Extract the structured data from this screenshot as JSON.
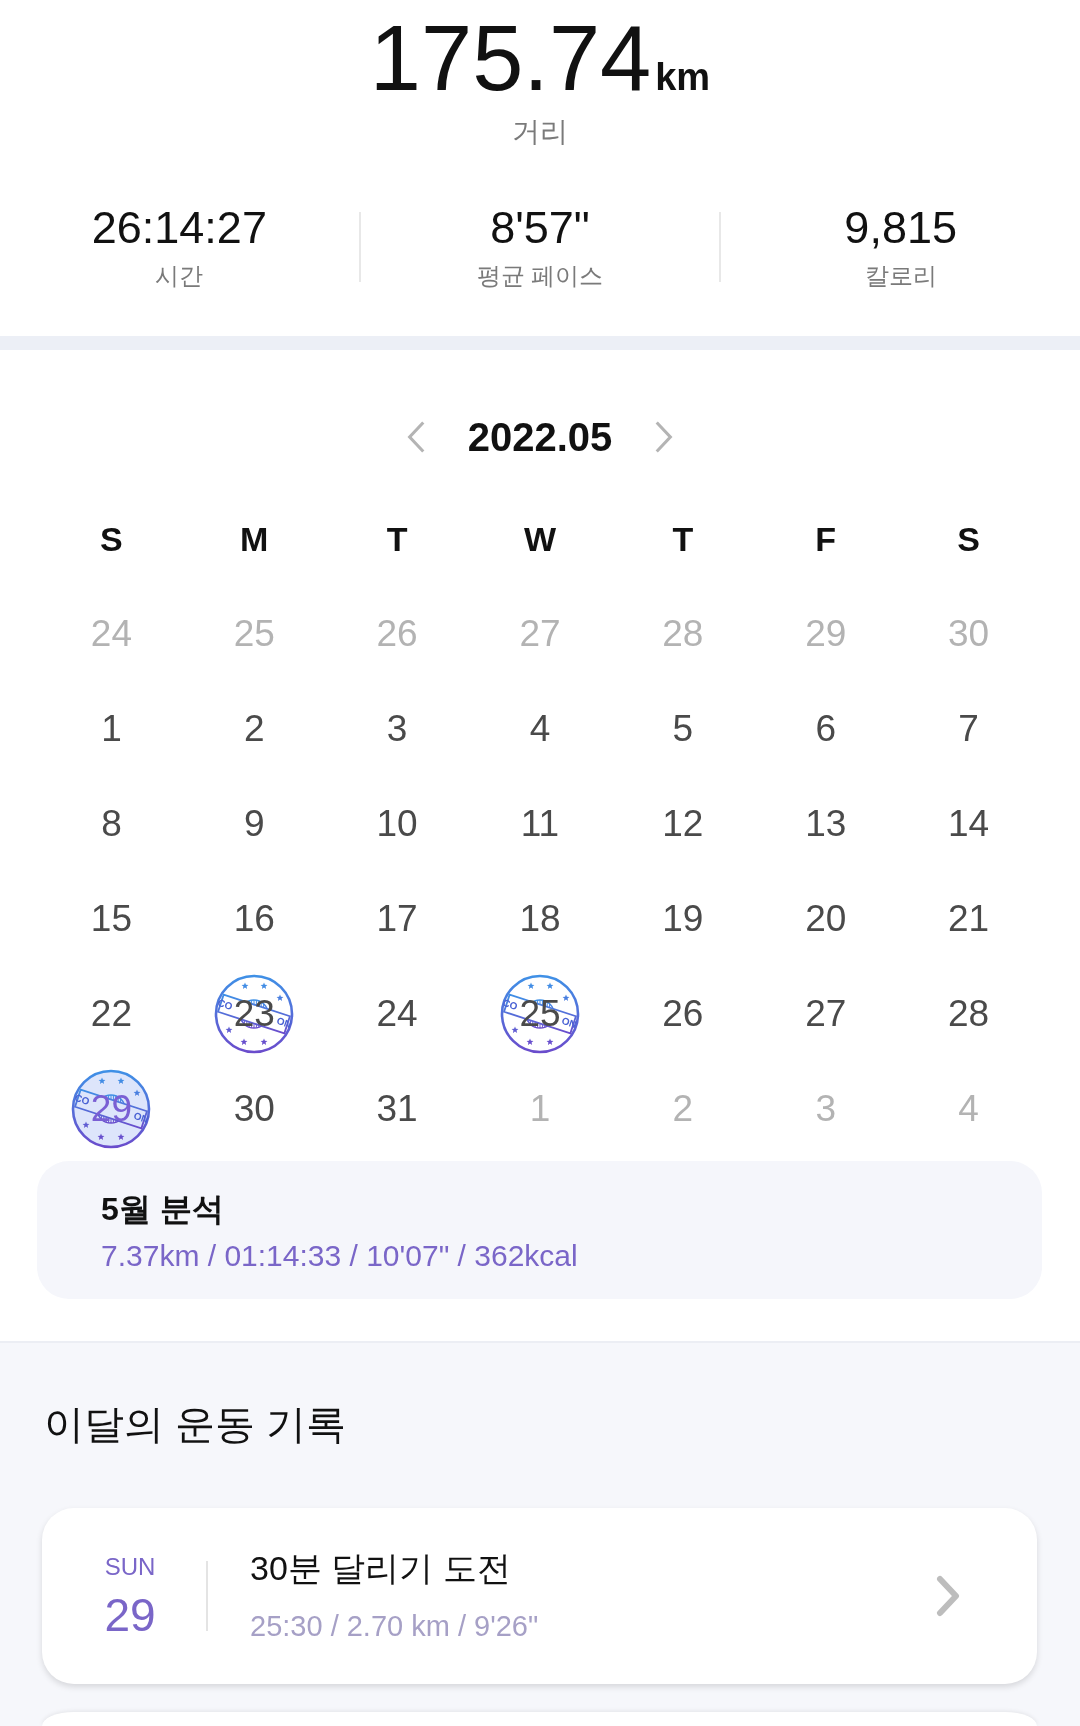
{
  "summary": {
    "distance": {
      "value": "175.74",
      "unit": "km",
      "label": "거리"
    },
    "stats": [
      {
        "value": "26:14:27",
        "label": "시간"
      },
      {
        "value": "8'57\"",
        "label": "평균 페이스"
      },
      {
        "value": "9,815",
        "label": "칼로리"
      }
    ]
  },
  "calendar": {
    "month": "2022.05",
    "weekdays": [
      "S",
      "M",
      "T",
      "W",
      "T",
      "F",
      "S"
    ],
    "weeks": [
      [
        {
          "day": "24",
          "outside_month": true,
          "completed": false,
          "selected": false
        },
        {
          "day": "25",
          "outside_month": true,
          "completed": false,
          "selected": false
        },
        {
          "day": "26",
          "outside_month": true,
          "completed": false,
          "selected": false
        },
        {
          "day": "27",
          "outside_month": true,
          "completed": false,
          "selected": false
        },
        {
          "day": "28",
          "outside_month": true,
          "completed": false,
          "selected": false
        },
        {
          "day": "29",
          "outside_month": true,
          "completed": false,
          "selected": false
        },
        {
          "day": "30",
          "outside_month": true,
          "completed": false,
          "selected": false
        }
      ],
      [
        {
          "day": "1",
          "outside_month": false,
          "completed": false,
          "selected": false
        },
        {
          "day": "2",
          "outside_month": false,
          "completed": false,
          "selected": false
        },
        {
          "day": "3",
          "outside_month": false,
          "completed": false,
          "selected": false
        },
        {
          "day": "4",
          "outside_month": false,
          "completed": false,
          "selected": false
        },
        {
          "day": "5",
          "outside_month": false,
          "completed": false,
          "selected": false
        },
        {
          "day": "6",
          "outside_month": false,
          "completed": false,
          "selected": false
        },
        {
          "day": "7",
          "outside_month": false,
          "completed": false,
          "selected": false
        }
      ],
      [
        {
          "day": "8",
          "outside_month": false,
          "completed": false,
          "selected": false
        },
        {
          "day": "9",
          "outside_month": false,
          "completed": false,
          "selected": false
        },
        {
          "day": "10",
          "outside_month": false,
          "completed": false,
          "selected": false
        },
        {
          "day": "11",
          "outside_month": false,
          "completed": false,
          "selected": false
        },
        {
          "day": "12",
          "outside_month": false,
          "completed": false,
          "selected": false
        },
        {
          "day": "13",
          "outside_month": false,
          "completed": false,
          "selected": false
        },
        {
          "day": "14",
          "outside_month": false,
          "completed": false,
          "selected": false
        }
      ],
      [
        {
          "day": "15",
          "outside_month": false,
          "completed": false,
          "selected": false
        },
        {
          "day": "16",
          "outside_month": false,
          "completed": false,
          "selected": false
        },
        {
          "day": "17",
          "outside_month": false,
          "completed": false,
          "selected": false
        },
        {
          "day": "18",
          "outside_month": false,
          "completed": false,
          "selected": false
        },
        {
          "day": "19",
          "outside_month": false,
          "completed": false,
          "selected": false
        },
        {
          "day": "20",
          "outside_month": false,
          "completed": false,
          "selected": false
        },
        {
          "day": "21",
          "outside_month": false,
          "completed": false,
          "selected": false
        }
      ],
      [
        {
          "day": "22",
          "outside_month": false,
          "completed": false,
          "selected": false
        },
        {
          "day": "23",
          "outside_month": false,
          "completed": true,
          "selected": false,
          "stamp_label_parts": [
            "CO",
            "ON"
          ]
        },
        {
          "day": "24",
          "outside_month": false,
          "completed": false,
          "selected": false
        },
        {
          "day": "25",
          "outside_month": false,
          "completed": true,
          "selected": false,
          "stamp_label_parts": [
            "CO",
            "ON"
          ]
        },
        {
          "day": "26",
          "outside_month": false,
          "completed": false,
          "selected": false
        },
        {
          "day": "27",
          "outside_month": false,
          "completed": false,
          "selected": false
        },
        {
          "day": "28",
          "outside_month": false,
          "completed": false,
          "selected": false
        }
      ],
      [
        {
          "day": "29",
          "outside_month": false,
          "completed": true,
          "selected": true,
          "stamp_label_parts": [
            "CO",
            "ON"
          ]
        },
        {
          "day": "30",
          "outside_month": false,
          "completed": false,
          "selected": false
        },
        {
          "day": "31",
          "outside_month": false,
          "completed": false,
          "selected": false
        },
        {
          "day": "1",
          "outside_month": true,
          "completed": false,
          "selected": false
        },
        {
          "day": "2",
          "outside_month": true,
          "completed": false,
          "selected": false
        },
        {
          "day": "3",
          "outside_month": true,
          "completed": false,
          "selected": false
        },
        {
          "day": "4",
          "outside_month": true,
          "completed": false,
          "selected": false
        }
      ]
    ]
  },
  "month_analysis": {
    "title": "5월 분석",
    "summary": "7.37km / 01:14:33 / 10'07\" / 362kcal"
  },
  "records": {
    "title": "이달의 운동 기록",
    "items": [
      {
        "weekday": "SUN",
        "day": "29",
        "title": "30분 달리기 도전",
        "details": "25:30 / 2.70 km / 9'26\""
      }
    ]
  }
}
